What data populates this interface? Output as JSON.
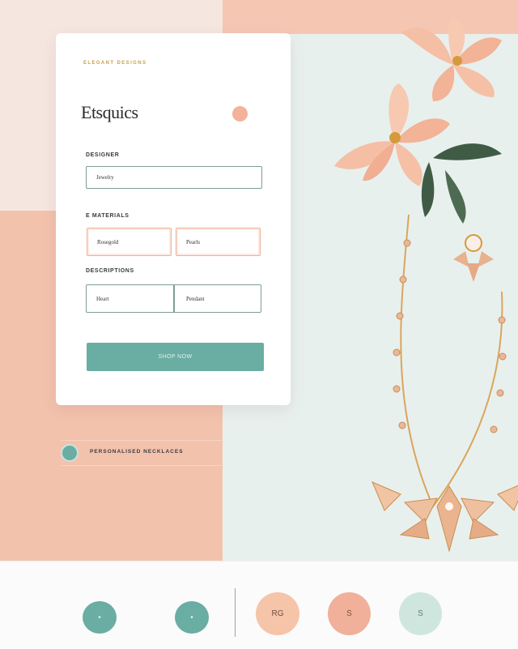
{
  "card": {
    "eyebrow": "ELEGANT DESIGNS",
    "brand": "Etsquics",
    "fields": [
      {
        "label": "DESIGNER",
        "value": "Jewelry"
      },
      {
        "label": "E MATERIALS",
        "values": [
          "Rosegold",
          "Pearls"
        ]
      },
      {
        "label": "DESCRIPTIONS",
        "values": [
          "Heart",
          "Pendant"
        ]
      }
    ],
    "submit_label": "SHOP NOW"
  },
  "feature": {
    "label": "PERSONALISED NECKLACES"
  },
  "swatches": [
    {
      "label": "•",
      "color": "#6aada3"
    },
    {
      "label": "•",
      "color": "#6aada3"
    },
    {
      "label": "RG",
      "color": "#f6c4a9"
    },
    {
      "label": "S",
      "color": "#f1b09a"
    },
    {
      "label": "S",
      "color": "#cfe6df"
    }
  ],
  "colors": {
    "peach": "#f3c2ad",
    "mint": "#e8f0ee",
    "teal": "#6aada3",
    "gold": "#c9a04b",
    "petal": "#f4b29a"
  }
}
